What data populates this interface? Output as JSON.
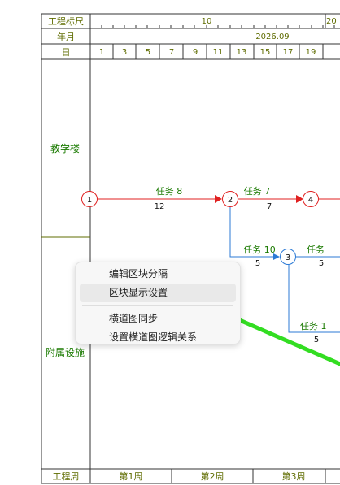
{
  "header": {
    "scale_label": "工程标尺",
    "scale_ticks": [
      "10",
      "20"
    ],
    "month_label": "年月",
    "month_value": "2026.09",
    "day_label": "日",
    "days": [
      "1",
      "3",
      "5",
      "7",
      "9",
      "11",
      "13",
      "15",
      "17",
      "19"
    ]
  },
  "blocks": {
    "teaching": "教学楼",
    "ancillary": "附属设施"
  },
  "tasks": {
    "t8": {
      "name": "任务 8",
      "duration": "12"
    },
    "t7": {
      "name": "任务 7",
      "duration": "7"
    },
    "t10": {
      "name": "任务 10",
      "duration": "5"
    },
    "t11": {
      "name": "任务 ",
      "duration": "5"
    },
    "t12": {
      "name": "任务 1",
      "duration": "5"
    },
    "from_node2_duration": "5"
  },
  "nodes": [
    "1",
    "2",
    "3",
    "4"
  ],
  "footer": {
    "label": "工程周",
    "weeks": [
      "第1周",
      "第2周",
      "第3周"
    ]
  },
  "context_menu": {
    "items": [
      "编辑区块分隔",
      "区块显示设置",
      "横道图同步",
      "设置横道图逻辑关系"
    ],
    "highlighted_index": 1
  },
  "colors": {
    "olive": "#5f6c00",
    "green_text": "#1a7a00",
    "critical_red": "#e02020",
    "link_blue": "#2b7ad6",
    "annotation_arrow": "#33dd22"
  }
}
